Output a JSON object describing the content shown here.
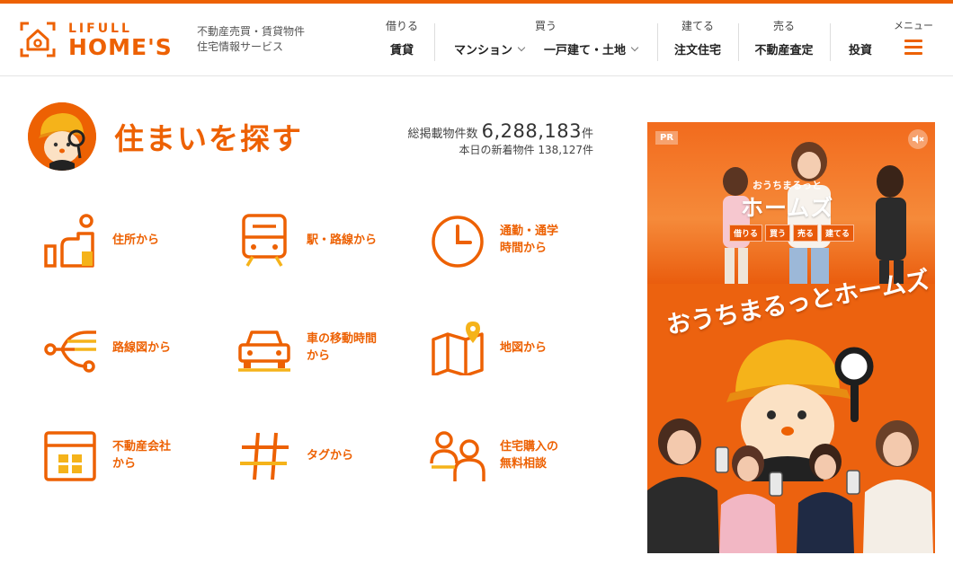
{
  "brand": {
    "line1": "LIFULL",
    "line2": "HOME'S",
    "tagline_1": "不動産売買・賃貸物件",
    "tagline_2": "住宅情報サービス",
    "accent": "#ed6103"
  },
  "nav": [
    {
      "category": "借りる",
      "items": [
        {
          "label": "賃貸",
          "chevron": false
        }
      ]
    },
    {
      "category": "買う",
      "items": [
        {
          "label": "マンション",
          "chevron": true
        },
        {
          "label": "一戸建て・土地",
          "chevron": true
        }
      ]
    },
    {
      "category": "建てる",
      "items": [
        {
          "label": "注文住宅",
          "chevron": false
        }
      ]
    },
    {
      "category": "売る",
      "items": [
        {
          "label": "不動産査定",
          "chevron": false
        }
      ]
    },
    {
      "category": "",
      "items": [
        {
          "label": "投資",
          "chevron": false
        }
      ]
    }
  ],
  "menu": {
    "label": "メニュー",
    "icon": "hamburger-icon"
  },
  "search": {
    "title": "住まいを探す",
    "total_label": "総掲載物件数",
    "total_value": "6,288,183",
    "total_unit": "件",
    "new_label": "本日の新着物件",
    "new_value": "138,127",
    "new_unit": "件"
  },
  "tiles": [
    {
      "label": "住所から",
      "icon": "address-map-icon"
    },
    {
      "label": "駅・路線から",
      "icon": "train-icon"
    },
    {
      "label": "通勤・通学\n時間から",
      "icon": "clock-icon"
    },
    {
      "label": "路線図から",
      "icon": "route-map-icon"
    },
    {
      "label": "車の移動時間\nから",
      "icon": "car-icon"
    },
    {
      "label": "地図から",
      "icon": "map-icon"
    },
    {
      "label": "不動産会社\nから",
      "icon": "building-icon"
    },
    {
      "label": "タグから",
      "icon": "hashtag-icon"
    },
    {
      "label": "住宅購入の\n無料相談",
      "icon": "consultation-icon"
    }
  ],
  "ad": {
    "pr": "PR",
    "sub": "おうちまるっと",
    "big": "ホームズ",
    "chips": [
      "借りる",
      "買う",
      "売る",
      "建てる"
    ],
    "slogan": "おうちまるっとホームズ"
  }
}
